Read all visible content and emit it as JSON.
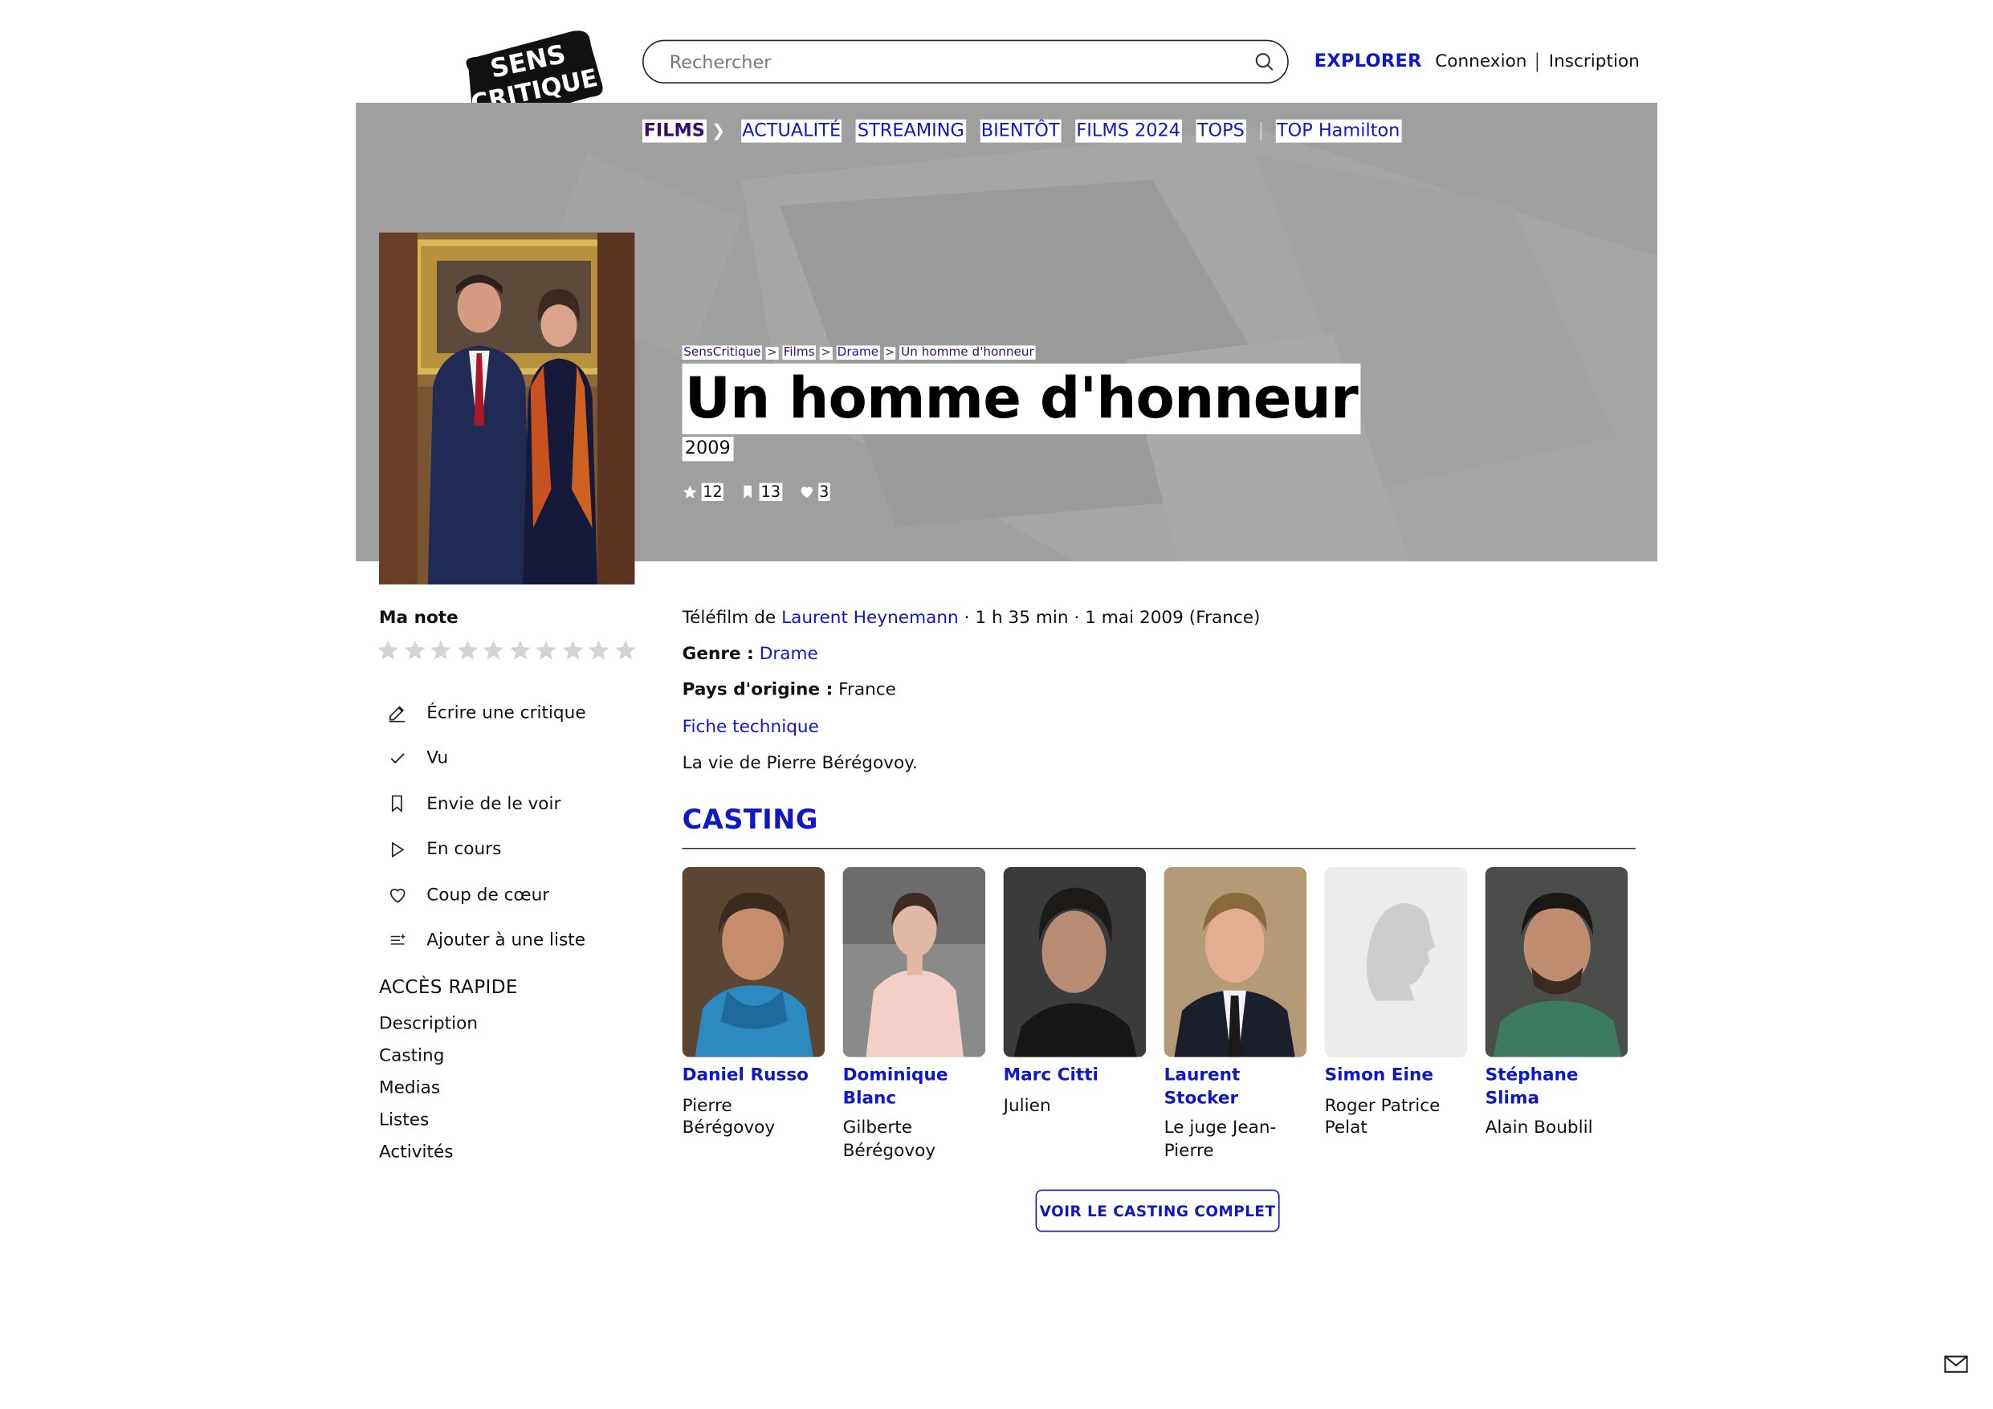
{
  "header": {
    "logo_text": "SENS CRITIQUE",
    "search_placeholder": "Rechercher",
    "explore_label": "EXPLORER",
    "login_label": "Connexion",
    "signup_label": "Inscription"
  },
  "subnav": {
    "section": "FILMS",
    "items": [
      "ACTUALITÉ",
      "STREAMING",
      "BIENTÔT",
      "FILMS 2024",
      "TOPS"
    ],
    "extra": "TOP Hamilton"
  },
  "breadcrumb": [
    "SensCritique",
    "Films",
    "Drame",
    "Un homme d'honneur"
  ],
  "movie": {
    "title": "Un homme d'honneur",
    "year": "2009",
    "stats": {
      "ratings": "12",
      "wishlists": "13",
      "favorites": "3"
    },
    "type_prefix": "Téléfilm de",
    "director": "Laurent Heynemann",
    "details": " · 1 h 35 min · 1 mai 2009 (France)",
    "genre_label": "Genre :",
    "genre": "Drame",
    "country_label": "Pays d'origine :",
    "country": "France",
    "technical_sheet": "Fiche technique",
    "synopsis": "La vie de Pierre Bérégovoy."
  },
  "sidebar": {
    "my_rating_label": "Ma note",
    "star_count": 10,
    "actions": [
      {
        "icon": "pencil-icon",
        "label": "Écrire une critique"
      },
      {
        "icon": "check-icon",
        "label": "Vu"
      },
      {
        "icon": "bookmark-icon",
        "label": "Envie de le voir"
      },
      {
        "icon": "play-icon",
        "label": "En cours"
      },
      {
        "icon": "heart-icon",
        "label": "Coup de cœur"
      },
      {
        "icon": "list-add-icon",
        "label": "Ajouter à une liste"
      }
    ],
    "quick_access_title": "ACCÈS RAPIDE",
    "quick_links": [
      "Description",
      "Casting",
      "Medias",
      "Listes",
      "Activités"
    ]
  },
  "casting": {
    "title": "CASTING",
    "members": [
      {
        "actor": "Daniel Russo",
        "role": "Pierre Bérégovoy"
      },
      {
        "actor": "Dominique Blanc",
        "role": "Gilberte Bérégovoy"
      },
      {
        "actor": "Marc Citti",
        "role": "Julien"
      },
      {
        "actor": "Laurent Stocker",
        "role": "Le juge Jean-Pierre"
      },
      {
        "actor": "Simon Eine",
        "role": "Roger Patrice Pelat"
      },
      {
        "actor": "Stéphane Slima",
        "role": "Alain Boublil"
      }
    ],
    "full_casting_button": "VOIR LE CASTING COMPLET"
  },
  "colors": {
    "accent": "#0f18c8",
    "banner": "#9f9f9f",
    "purple": "#3a0a6e"
  }
}
